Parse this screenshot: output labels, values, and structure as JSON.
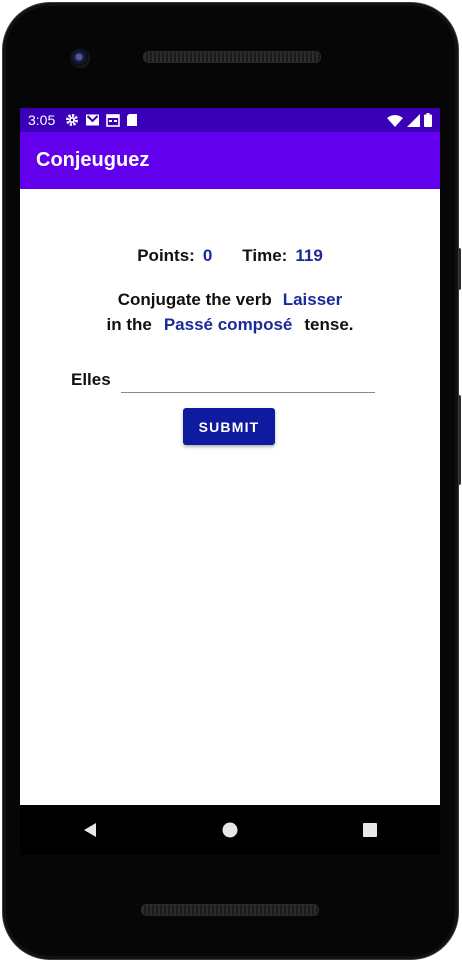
{
  "status_bar": {
    "time": "3:05",
    "left_icons": [
      "gear-icon",
      "gmail-icon",
      "calendar-icon",
      "sd-card-icon"
    ],
    "right_icons": [
      "wifi-icon",
      "signal-icon",
      "battery-icon"
    ]
  },
  "app_bar": {
    "title": "Conjeuguez"
  },
  "score": {
    "points_label": "Points:",
    "points_value": "0",
    "time_label": "Time:",
    "time_value": "119"
  },
  "prompt": {
    "line1_prefix": "Conjugate the verb",
    "verb": "Laisser",
    "line2_prefix": "in the",
    "tense": "Passé composé",
    "line2_suffix": "tense."
  },
  "answer": {
    "pronoun": "Elles",
    "value": "",
    "placeholder": ""
  },
  "submit_label": "SUBMIT",
  "nav": [
    "back-icon",
    "home-icon",
    "recents-icon"
  ],
  "colors": {
    "status_bar": "#3a00b8",
    "app_bar": "#6200ee",
    "accent_text": "#1a2a99",
    "button": "#0e1b9f"
  }
}
